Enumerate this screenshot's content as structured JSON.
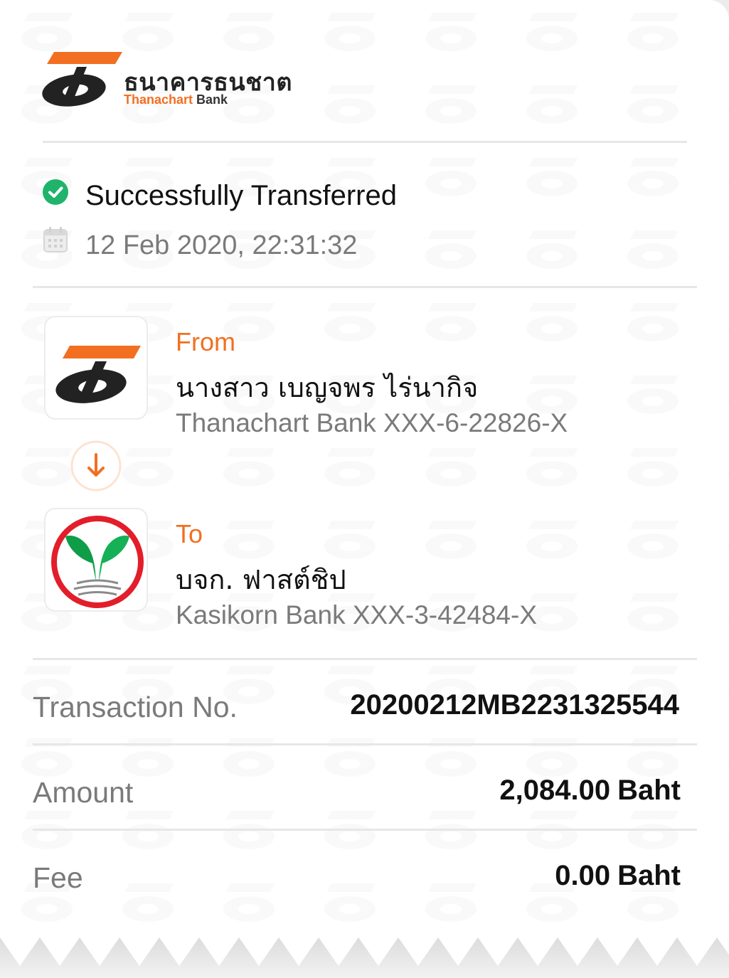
{
  "brand": {
    "name_thai": "ธนาคารธนชาต",
    "name_en_1": "Thanachart",
    "name_en_2": "Bank",
    "logo_icon": "thanachart-logo-icon",
    "accent_color": "#f26f21"
  },
  "status": {
    "icon": "check-circle-icon",
    "text": "Successfully Transferred",
    "color": "#1fb36b"
  },
  "datetime": {
    "icon": "calendar-icon",
    "text": "12 Feb 2020, 22:31:32"
  },
  "from": {
    "label": "From",
    "name": "นางสาว เบญจพร ไร่นากิจ",
    "account": "Thanachart Bank XXX-6-22826-X",
    "bank_icon": "thanachart-logo-icon"
  },
  "direction_icon": "arrow-down-icon",
  "to": {
    "label": "To",
    "name": "บจก. ฟาสต์ชิป",
    "account": "Kasikorn Bank XXX-3-42484-X",
    "bank_icon": "kasikorn-logo-icon"
  },
  "details": {
    "transaction": {
      "label": "Transaction No.",
      "value": "20200212MB2231325544"
    },
    "amount": {
      "label": "Amount",
      "value": "2,084.00",
      "unit": "Baht"
    },
    "fee": {
      "label": "Fee",
      "value": "0.00",
      "unit": "Baht"
    }
  }
}
